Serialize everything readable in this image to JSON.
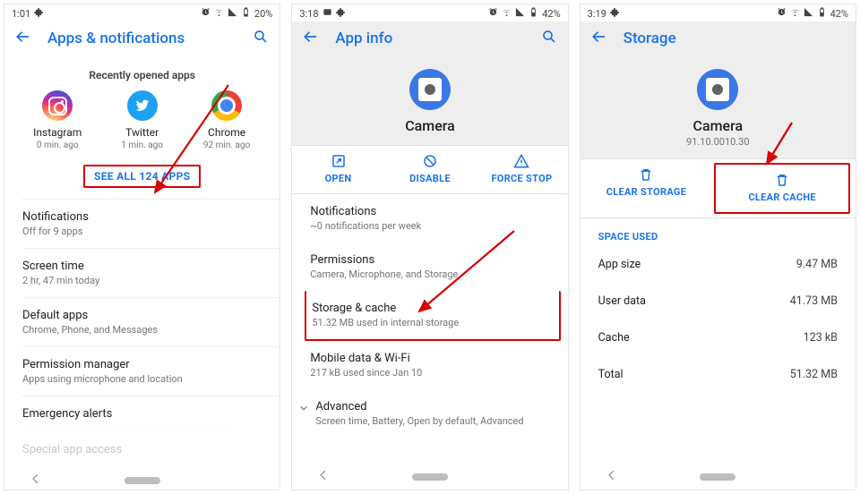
{
  "screen1": {
    "status": {
      "time": "1:01",
      "battery": "20%"
    },
    "toolbar": {
      "title": "Apps & notifications"
    },
    "recent_heading": "Recently opened apps",
    "apps": [
      {
        "name": "Instagram",
        "sub": "0 min. ago"
      },
      {
        "name": "Twitter",
        "sub": "1 min. ago"
      },
      {
        "name": "Chrome",
        "sub": "92 min. ago"
      }
    ],
    "see_all": "SEE ALL 124 APPS",
    "items": [
      {
        "primary": "Notifications",
        "secondary": "Off for 9 apps"
      },
      {
        "primary": "Screen time",
        "secondary": "2 hr, 47 min today"
      },
      {
        "primary": "Default apps",
        "secondary": "Chrome, Phone, and Messages"
      },
      {
        "primary": "Permission manager",
        "secondary": "Apps using microphone and location"
      },
      {
        "primary": "Emergency alerts",
        "secondary": ""
      },
      {
        "primary": "Special app access",
        "secondary": ""
      }
    ]
  },
  "screen2": {
    "status": {
      "time": "3:18",
      "battery": "42%"
    },
    "toolbar": {
      "title": "App info"
    },
    "app_name": "Camera",
    "actions": {
      "open": "OPEN",
      "disable": "DISABLE",
      "force_stop": "FORCE STOP"
    },
    "items": [
      {
        "primary": "Notifications",
        "secondary": "~0 notifications per week"
      },
      {
        "primary": "Permissions",
        "secondary": "Camera, Microphone, and Storage"
      },
      {
        "primary": "Storage & cache",
        "secondary": "51.32 MB used in internal storage"
      },
      {
        "primary": "Mobile data & Wi-Fi",
        "secondary": "217 kB used since Jan 10"
      },
      {
        "primary": "Advanced",
        "secondary": "Screen time, Battery, Open by default, Advanced"
      }
    ]
  },
  "screen3": {
    "status": {
      "time": "3:19",
      "battery": "42%"
    },
    "toolbar": {
      "title": "Storage"
    },
    "app_name": "Camera",
    "version": "91.10.0010.30",
    "actions": {
      "clear_storage": "CLEAR STORAGE",
      "clear_cache": "CLEAR CACHE"
    },
    "space_used_label": "SPACE USED",
    "rows": [
      {
        "k": "App size",
        "v": "9.47 MB"
      },
      {
        "k": "User data",
        "v": "41.73 MB"
      },
      {
        "k": "Cache",
        "v": "123 kB"
      },
      {
        "k": "Total",
        "v": "51.32 MB"
      }
    ]
  }
}
